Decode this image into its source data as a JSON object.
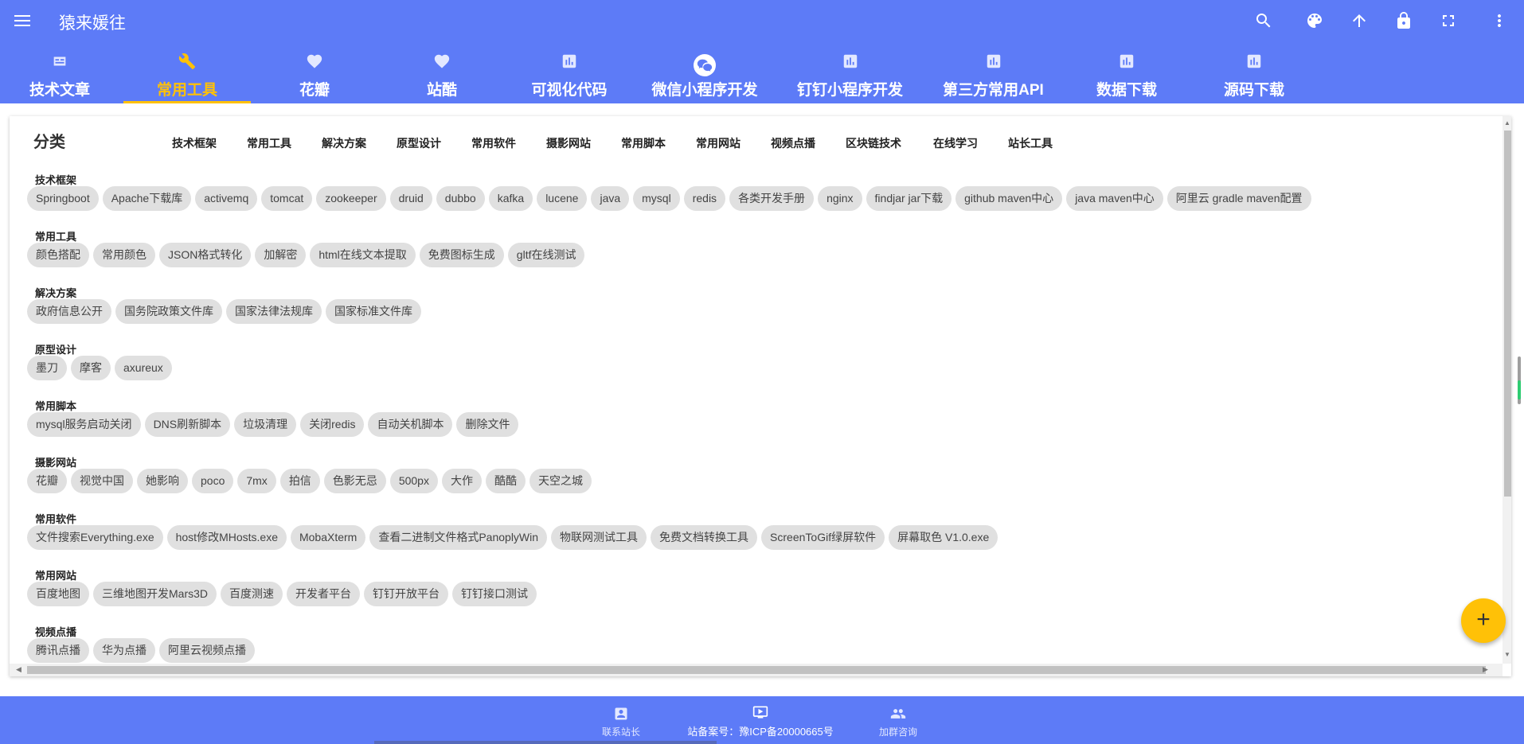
{
  "app": {
    "title": "猿来媛往"
  },
  "tabs": [
    {
      "label": "技术文章",
      "icon": "article-icon",
      "active": false
    },
    {
      "label": "常用工具",
      "icon": "wrench-icon",
      "active": true
    },
    {
      "label": "花瓣",
      "icon": "heart-icon",
      "active": false
    },
    {
      "label": "站酷",
      "icon": "heart-icon",
      "active": false
    },
    {
      "label": "可视化代码",
      "icon": "chart-icon",
      "active": false
    },
    {
      "label": "微信小程序开发",
      "icon": "wechat-icon",
      "active": false
    },
    {
      "label": "钉钉小程序开发",
      "icon": "chart-icon",
      "active": false
    },
    {
      "label": "第三方常用API",
      "icon": "chart-icon",
      "active": false
    },
    {
      "label": "数据下载",
      "icon": "chart-icon",
      "active": false
    },
    {
      "label": "源码下载",
      "icon": "chart-icon",
      "active": false
    }
  ],
  "top_actions": [
    "search-icon",
    "palette-icon",
    "arrow-up-icon",
    "lock-icon",
    "fullscreen-icon",
    "more-vert-icon"
  ],
  "category_bar": {
    "heading": "分类",
    "links": [
      "技术框架",
      "常用工具",
      "解决方案",
      "原型设计",
      "常用软件",
      "摄影网站",
      "常用脚本",
      "常用网站",
      "视频点播",
      "区块链技术",
      "在线学习",
      "站长工具"
    ]
  },
  "sections": [
    {
      "title": "技术框架",
      "chips": [
        "Springboot",
        "Apache下载库",
        "activemq",
        "tomcat",
        "zookeeper",
        "druid",
        "dubbo",
        "kafka",
        "lucene",
        "java",
        "mysql",
        "redis",
        "各类开发手册",
        "nginx",
        "findjar jar下载",
        "github maven中心",
        "java maven中心",
        "阿里云 gradle maven配置"
      ]
    },
    {
      "title": "常用工具",
      "chips": [
        "颜色搭配",
        "常用颜色",
        "JSON格式转化",
        "加解密",
        "html在线文本提取",
        "免费图标生成",
        "gltf在线测试"
      ]
    },
    {
      "title": "解决方案",
      "chips": [
        "政府信息公开",
        "国务院政策文件库",
        "国家法律法规库",
        "国家标准文件库"
      ]
    },
    {
      "title": "原型设计",
      "chips": [
        "墨刀",
        "摩客",
        "axureux"
      ]
    },
    {
      "title": "常用脚本",
      "chips": [
        "mysql服务启动关闭",
        "DNS刷新脚本",
        "垃圾清理",
        "关闭redis",
        "自动关机脚本",
        "删除文件"
      ]
    },
    {
      "title": "摄影网站",
      "chips": [
        "花瓣",
        "视觉中国",
        "她影响",
        "poco",
        "7mx",
        "拍信",
        "色影无忌",
        "500px",
        "大作",
        "酷酷",
        "天空之城"
      ]
    },
    {
      "title": "常用软件",
      "chips": [
        "文件搜索Everything.exe",
        "host修改MHosts.exe",
        "MobaXterm",
        "查看二进制文件格式PanoplyWin",
        "物联网测试工具",
        "免费文档转换工具",
        "ScreenToGif绿屏软件",
        "屏幕取色 V1.0.exe"
      ]
    },
    {
      "title": "常用网站",
      "chips": [
        "百度地图",
        "三维地图开发Mars3D",
        "百度测速",
        "开发者平台",
        "钉钉开放平台",
        "钉钉接口测试"
      ]
    },
    {
      "title": "视频点播",
      "chips": [
        "腾讯点播",
        "华为点播",
        "阿里云视频点播"
      ]
    }
  ],
  "fab": {
    "label": "+"
  },
  "footer": {
    "contact_label": "联系站长",
    "icp_label": "站备案号：豫ICP备20000665号",
    "group_label": "加群咨询"
  }
}
